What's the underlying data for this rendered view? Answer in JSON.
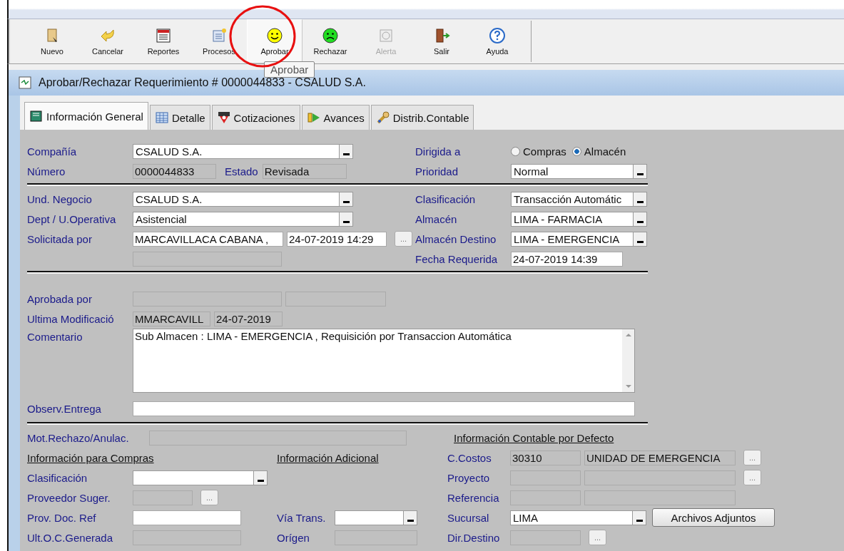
{
  "toolbar": [
    {
      "label": "Nuevo",
      "kind": "scroll",
      "disabled": false,
      "hovered": false
    },
    {
      "label": "Cancelar",
      "kind": "undo",
      "disabled": false,
      "hovered": false
    },
    {
      "label": "Reportes",
      "kind": "report",
      "disabled": false,
      "hovered": false
    },
    {
      "label": "Procesos",
      "kind": "process",
      "disabled": false,
      "hovered": false
    },
    {
      "label": "Aprobar",
      "kind": "smile",
      "disabled": false,
      "hovered": true
    },
    {
      "label": "Rechazar",
      "kind": "frown",
      "disabled": false,
      "hovered": false
    },
    {
      "label": "Alerta",
      "kind": "alert",
      "disabled": true,
      "hovered": false
    },
    {
      "label": "Salir",
      "kind": "door",
      "disabled": false,
      "hovered": false
    },
    {
      "label": "Ayuda",
      "kind": "help",
      "disabled": false,
      "hovered": false
    }
  ],
  "tooltip": "Aprobar",
  "form": {
    "title": "Aprobar/Rechazar Requerimiento  # 0000044833 - CSALUD S.A.",
    "tabs": [
      {
        "label": "Información General",
        "kind": "book",
        "selected": true
      },
      {
        "label": "Detalle",
        "kind": "grid",
        "selected": false
      },
      {
        "label": "Cotizaciones",
        "kind": "badge",
        "selected": false
      },
      {
        "label": "Avances",
        "kind": "play",
        "selected": false
      },
      {
        "label": "Distrib.Contable",
        "kind": "key",
        "selected": false
      }
    ],
    "header_left": [
      {
        "label": "Compañía",
        "controls": [
          {
            "kind": "combo",
            "value": "CSALUD S.A."
          }
        ]
      },
      {
        "label": "Número",
        "controls": [
          {
            "kind": "readonly",
            "value": "0000044833"
          },
          {
            "kind": "label",
            "value": "Estado"
          },
          {
            "kind": "readonly",
            "value": "Revisada"
          }
        ]
      }
    ],
    "header_right": [
      {
        "label": "Dirigida a",
        "controls": [
          {
            "kind": "radio",
            "value": "Compras",
            "selected": false
          },
          {
            "kind": "radio",
            "value": "Almacén",
            "selected": true
          }
        ]
      },
      {
        "label": "Prioridad",
        "controls": [
          {
            "kind": "combo",
            "value": "Normal"
          }
        ]
      }
    ],
    "main_left": [
      {
        "label": "Und. Negocio",
        "controls": [
          {
            "kind": "combo",
            "value": "CSALUD S.A."
          }
        ]
      },
      {
        "label": "Dept / U.Operativa",
        "controls": [
          {
            "kind": "combo",
            "value": "Asistencial"
          }
        ]
      },
      {
        "label": "Solicitada por",
        "controls": [
          {
            "kind": "text",
            "value": "MARCAVILLACA CABANA ,"
          },
          {
            "kind": "text",
            "value": "24-07-2019  14:29"
          },
          {
            "kind": "button",
            "value": "..."
          }
        ]
      },
      {
        "controls": [
          {
            "kind": "readonly"
          }
        ]
      }
    ],
    "main_right": [
      {
        "label": "Clasificación",
        "controls": [
          {
            "kind": "combo",
            "value": "Transacción Automátic"
          }
        ]
      },
      {
        "label": "Almacén",
        "controls": [
          {
            "kind": "combo",
            "value": "LIMA - FARMACIA"
          }
        ]
      },
      {
        "label": "Almacén Destino",
        "controls": [
          {
            "kind": "combo",
            "value": "LIMA - EMERGENCIA"
          }
        ]
      },
      {
        "label": "Fecha Requerida",
        "controls": [
          {
            "kind": "text",
            "value": "24-07-2019 14:39"
          }
        ]
      }
    ],
    "details": [
      {
        "label": "Aprobada por",
        "controls": [
          {
            "kind": "readonly"
          },
          {
            "kind": "readonly"
          }
        ]
      },
      {
        "label": "Ultima Modificació",
        "controls": [
          {
            "kind": "readonly",
            "value": "MMARCAVILL"
          },
          {
            "kind": "readonly",
            "value": "24-07-2019"
          }
        ]
      },
      {
        "label": "Comentario",
        "controls": [
          {
            "kind": "textarea",
            "value": "Sub Almacen : LIMA - EMERGENCIA , Requisición por Transaccion Automática"
          }
        ]
      },
      {
        "label": "Observ.Entrega",
        "controls": [
          {
            "kind": "text"
          }
        ]
      }
    ],
    "rejection": [
      {
        "label": "Mot.Rechazo/Anulac.",
        "controls": [
          {
            "kind": "readonly"
          }
        ]
      }
    ],
    "purchases": {
      "heading": "Información para Compras",
      "rows": [
        {
          "label": "Clasificación",
          "controls": [
            {
              "kind": "combo"
            }
          ]
        },
        {
          "label": "Proveedor Suger.",
          "controls": [
            {
              "kind": "readonly"
            },
            {
              "kind": "button",
              "value": "..."
            }
          ]
        },
        {
          "label": "Prov. Doc. Ref",
          "controls": [
            {
              "kind": "text"
            }
          ]
        },
        {
          "label": "Ult.O.C.Generada",
          "controls": [
            {
              "kind": "readonly"
            }
          ]
        }
      ]
    },
    "additional": {
      "heading": "Información Adicional",
      "rows": [
        {
          "controls": []
        },
        {
          "controls": []
        },
        {
          "label": "Vía Trans.",
          "controls": [
            {
              "kind": "combo"
            }
          ]
        },
        {
          "label": "Orígen",
          "controls": [
            {
              "kind": "readonly"
            }
          ]
        }
      ]
    },
    "accounting": {
      "heading": "Información Contable por Defecto",
      "rows": [
        {
          "label": "C.Costos",
          "controls": [
            {
              "kind": "readonly",
              "value": "30310"
            },
            {
              "kind": "readonly",
              "value": "UNIDAD DE EMERGENCIA"
            },
            {
              "kind": "button",
              "value": "..."
            }
          ]
        },
        {
          "label": "Proyecto",
          "controls": [
            {
              "kind": "readonly"
            },
            {
              "kind": "readonly"
            },
            {
              "kind": "button",
              "value": "..."
            }
          ]
        },
        {
          "label": "Referencia",
          "controls": [
            {
              "kind": "readonly"
            },
            {
              "kind": "readonly"
            }
          ]
        },
        {
          "label": "Sucursal",
          "controls": [
            {
              "kind": "combo",
              "value": "LIMA"
            },
            {
              "kind": "push",
              "value": "Archivos Adjuntos"
            }
          ]
        },
        {
          "label": "Dir.Destino",
          "controls": [
            {
              "kind": "readonly"
            },
            {
              "kind": "button",
              "value": "..."
            }
          ]
        }
      ]
    }
  }
}
